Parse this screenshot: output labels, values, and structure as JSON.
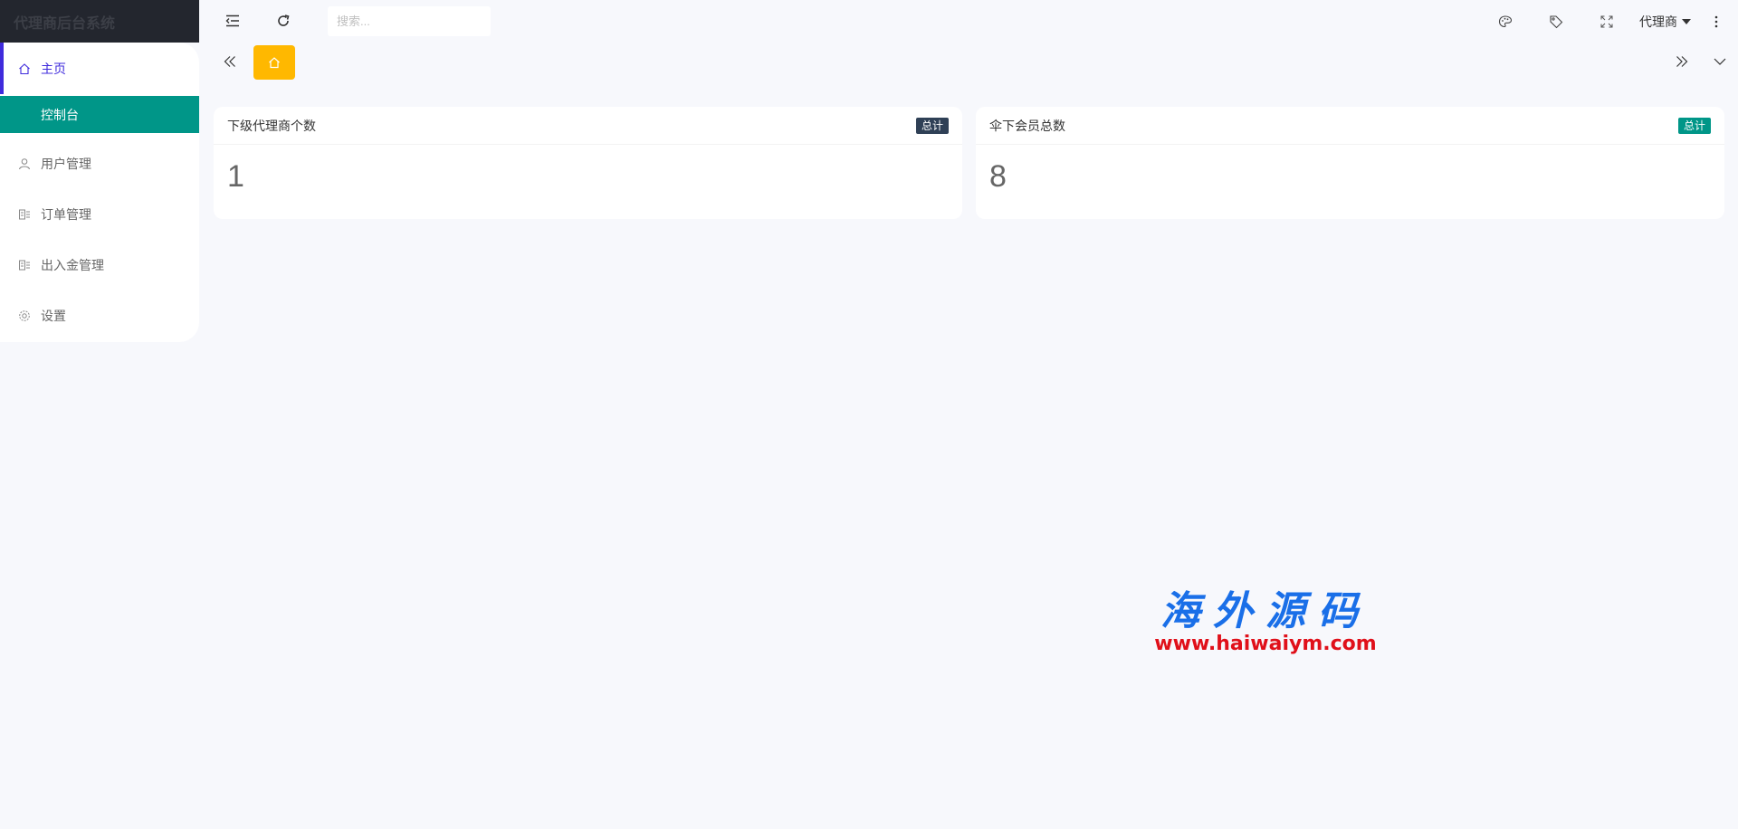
{
  "app": {
    "title": "代理商后台系统"
  },
  "sidebar": {
    "items": [
      {
        "label": "主页",
        "icon": "home-icon"
      },
      {
        "label": "控制台"
      },
      {
        "label": "用户管理",
        "icon": "user-icon"
      },
      {
        "label": "订单管理",
        "icon": "list-icon"
      },
      {
        "label": "出入金管理",
        "icon": "list-icon"
      },
      {
        "label": "设置",
        "icon": "gear-icon"
      }
    ]
  },
  "header": {
    "search_placeholder": "搜索...",
    "user_name": "代理商"
  },
  "cards": [
    {
      "title": "下级代理商个数",
      "badge": "总计",
      "badge_color": "#2f4056",
      "value": "1"
    },
    {
      "title": "伞下会员总数",
      "badge": "总计",
      "badge_color": "#009688",
      "value": "8"
    }
  ],
  "watermark": {
    "brand": "海外源码",
    "url": "www.haiwaiym.com"
  },
  "colors": {
    "accent": "#3f2bdc",
    "active_sub": "#009688",
    "home_tab": "#ffb800"
  }
}
